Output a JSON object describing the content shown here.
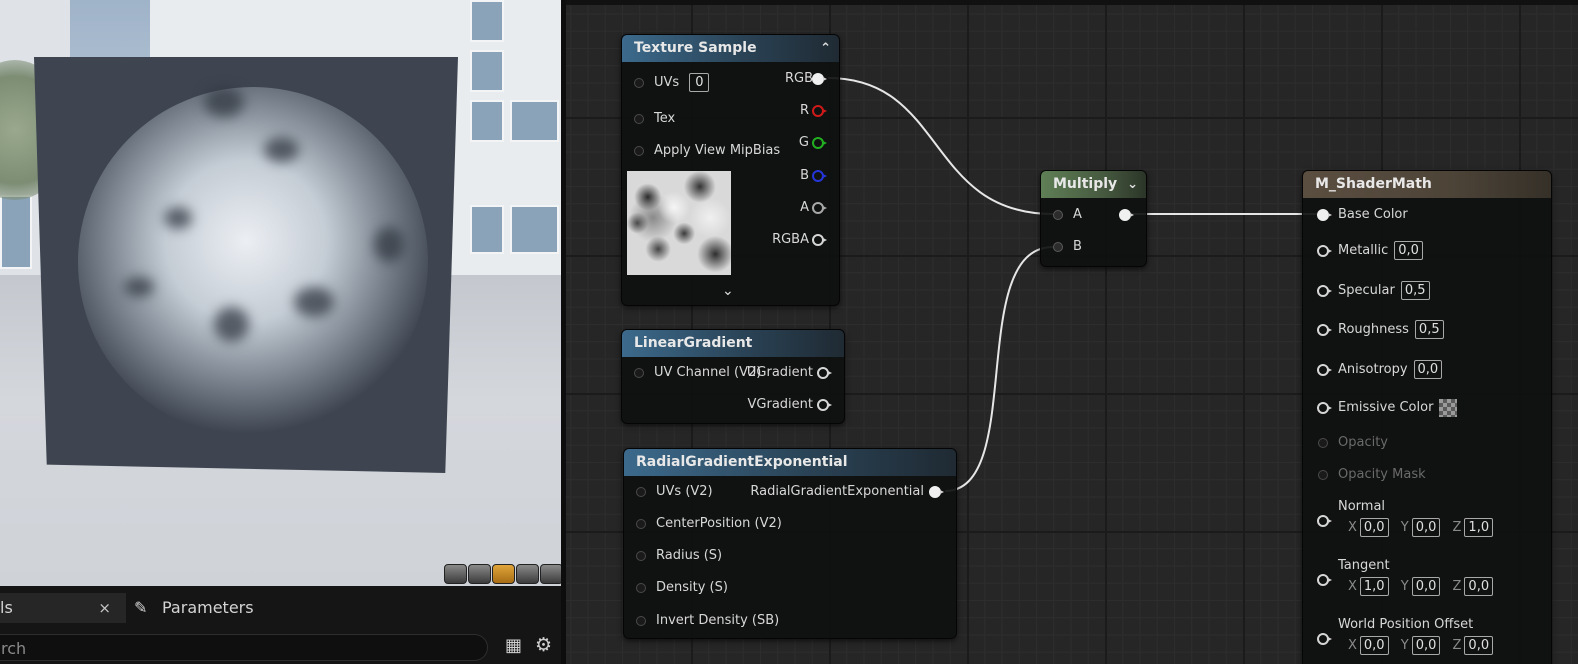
{
  "bottom_panel": {
    "details_tab_label": "ls",
    "close_glyph": "×",
    "parameters_tab_label": "Parameters",
    "search_placeholder": "rch"
  },
  "nodes": {
    "texture_sample": {
      "title": "Texture Sample",
      "collapse_glyph": "^",
      "expand_glyph": "⌄",
      "inputs": [
        {
          "label": "UVs",
          "value": "0"
        },
        {
          "label": "Tex"
        },
        {
          "label": "Apply View MipBias"
        }
      ],
      "outputs": [
        "RGB",
        "R",
        "G",
        "B",
        "A",
        "RGBA"
      ]
    },
    "linear_gradient": {
      "title": "LinearGradient",
      "input": "UV Channel (V2)",
      "outputs": [
        "UGradient",
        "VGradient"
      ]
    },
    "radial_gradient": {
      "title": "RadialGradientExponential",
      "inputs": [
        "UVs (V2)",
        "CenterPosition (V2)",
        "Radius (S)",
        "Density (S)",
        "Invert Density (SB)"
      ],
      "output": "RadialGradientExponential"
    },
    "multiply": {
      "title": "Multiply",
      "inputs": [
        "A",
        "B"
      ]
    },
    "material": {
      "title": "M_ShaderMath",
      "base_color": "Base Color",
      "metallic": {
        "label": "Metallic",
        "value": "0,0"
      },
      "specular": {
        "label": "Specular",
        "value": "0,5"
      },
      "roughness": {
        "label": "Roughness",
        "value": "0,5"
      },
      "anisotropy": {
        "label": "Anisotropy",
        "value": "0,0"
      },
      "emissive": "Emissive Color",
      "opacity": "Opacity",
      "opacity_mask": "Opacity Mask",
      "normal": {
        "label": "Normal",
        "x": "0,0",
        "y": "0,0",
        "z": "1,0"
      },
      "tangent": {
        "label": "Tangent",
        "x": "1,0",
        "y": "0,0",
        "z": "0,0"
      },
      "wpo": {
        "label": "World Position Offset",
        "x": "0,0",
        "y": "0,0",
        "z": "0,0"
      },
      "axis_labels": {
        "x": "X",
        "y": "Y",
        "z": "Z"
      }
    }
  },
  "colors": {
    "pin_r": "#d01a1a",
    "pin_g": "#22b022",
    "pin_b": "#2536d8",
    "header_texture": "#3c6a8c",
    "header_multiply": "#5f7f56",
    "header_material": "#5a4e40"
  },
  "icons": [
    "pencil-icon",
    "table-icon",
    "gear-icon",
    "close-icon",
    "chevron-up-icon",
    "chevron-down-icon"
  ]
}
